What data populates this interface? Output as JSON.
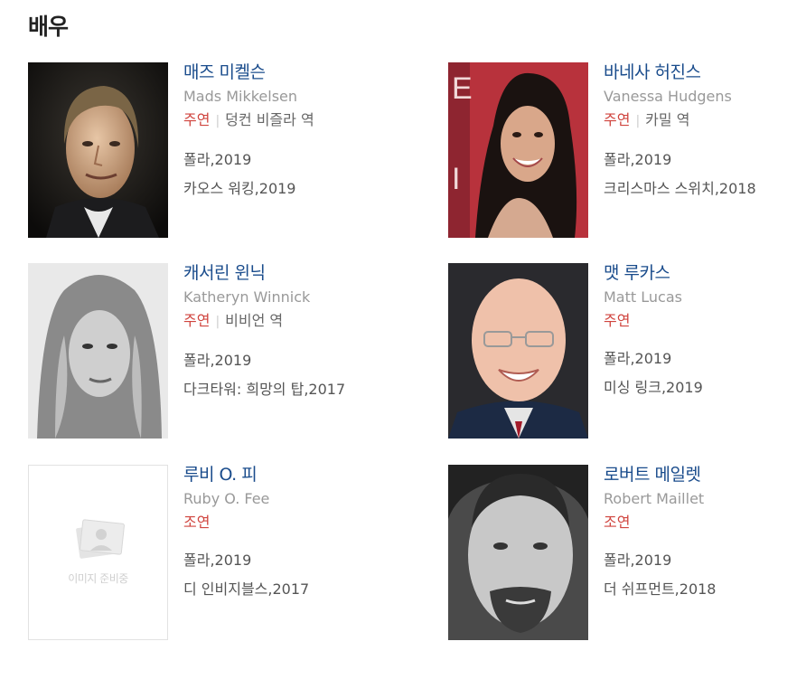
{
  "section_title": "배우",
  "actors": [
    {
      "name_ko": "매즈 미켈슨",
      "name_en": "Mads Mikkelsen",
      "role_type": "주연",
      "character": "덩컨 비즐라 역",
      "films": [
        "폴라,2019",
        "카오스 워킹,2019"
      ]
    },
    {
      "name_ko": "바네사 허진스",
      "name_en": "Vanessa Hudgens",
      "role_type": "주연",
      "character": "카밀 역",
      "films": [
        "폴라,2019",
        "크리스마스 스위치,2018"
      ]
    },
    {
      "name_ko": "캐서린 윈닉",
      "name_en": "Katheryn Winnick",
      "role_type": "주연",
      "character": "비비언 역",
      "films": [
        "폴라,2019",
        "다크타워: 희망의 탑,2017"
      ]
    },
    {
      "name_ko": "맷 루카스",
      "name_en": "Matt Lucas",
      "role_type": "주연",
      "character": "",
      "films": [
        "폴라,2019",
        "미싱 링크,2019"
      ]
    },
    {
      "name_ko": "루비 O. 피",
      "name_en": "Ruby O. Fee",
      "role_type": "조연",
      "character": "",
      "films": [
        "폴라,2019",
        "디 인비지블스,2017"
      ]
    },
    {
      "name_ko": "로버트 메일렛",
      "name_en": "Robert Maillet",
      "role_type": "조연",
      "character": "",
      "films": [
        "폴라,2019",
        "더 쉬프먼트,2018"
      ]
    }
  ],
  "placeholder_text": "이미지 준비중",
  "colors": {
    "link": "#1a4c8c",
    "role": "#d0453f",
    "muted": "#999999"
  }
}
